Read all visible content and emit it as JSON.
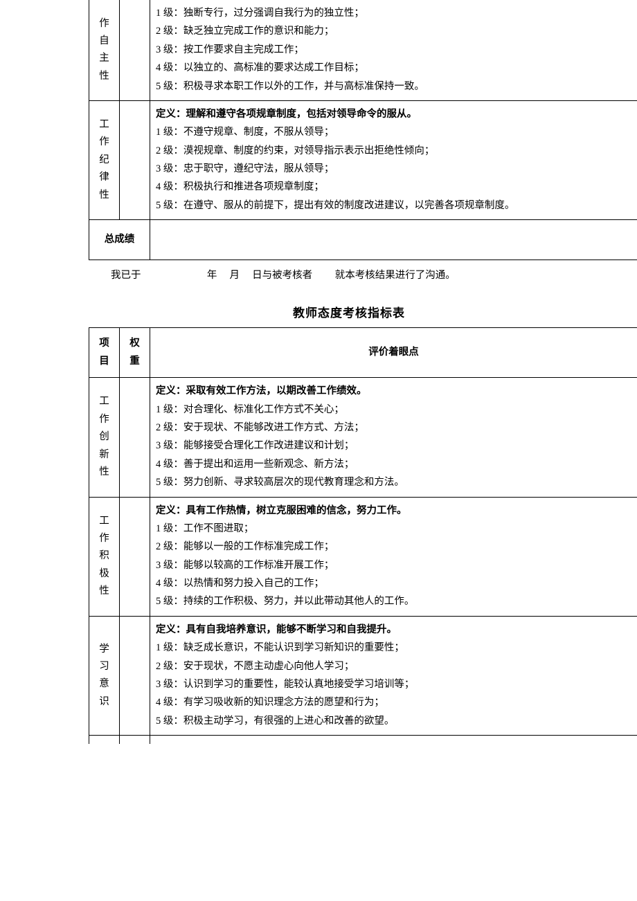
{
  "table1": {
    "rows": [
      {
        "item": [
          "作",
          "自",
          "主",
          "性"
        ],
        "weight": "",
        "content": {
          "definition": null,
          "levels": [
            {
              "n": "1",
              "t": "独断专行，过分强调自我行为的独立性；"
            },
            {
              "n": "2",
              "t": "缺乏独立完成工作的意识和能力；"
            },
            {
              "n": "3",
              "t": "按工作要求自主完成工作；"
            },
            {
              "n": "4",
              "t": "以独立的、高标准的要求达成工作目标；"
            },
            {
              "n": "5",
              "t": "积极寻求本职工作以外的工作，并与高标准保持一致。"
            }
          ]
        }
      },
      {
        "item": [
          "工",
          "作",
          "纪",
          "律",
          "性"
        ],
        "weight": "",
        "content": {
          "definition": "定义：理解和遵守各项规章制度，包括对领导命令的服从。",
          "levels": [
            {
              "n": "1",
              "t": "不遵守规章、制度，不服从领导；"
            },
            {
              "n": "2",
              "t": "漠视规章、制度的约束，对领导指示表示出拒绝性倾向；"
            },
            {
              "n": "3",
              "t": "忠于职守，遵纪守法，服从领导；"
            },
            {
              "n": "4",
              "t": "积极执行和推进各项规章制度；"
            },
            {
              "n": "5",
              "t": "在遵守、服从的前提下，提出有效的制度改进建议，以完善各项规章制度。"
            }
          ]
        }
      }
    ],
    "total_label": "总成绩",
    "total_value": ""
  },
  "footer": {
    "prefix": "我已于",
    "year_label": "年",
    "month_label": "月",
    "day_label": "日与被考核者",
    "suffix": "就本考核结果进行了沟通。"
  },
  "table2": {
    "title": "教师态度考核指标表",
    "headers": {
      "item": "项目",
      "weight": "权重",
      "content": "评价着眼点"
    },
    "rows": [
      {
        "item": [
          "工",
          "作",
          "创",
          "新",
          "性"
        ],
        "weight": "",
        "content": {
          "definition": "定义：采取有效工作方法，以期改善工作绩效。",
          "levels": [
            {
              "n": "1",
              "t": "对合理化、标准化工作方式不关心；"
            },
            {
              "n": "2",
              "t": "安于现状、不能够改进工作方式、方法；"
            },
            {
              "n": "3",
              "t": "能够接受合理化工作改进建议和计划；"
            },
            {
              "n": "4",
              "t": "善于提出和运用一些新观念、新方法；"
            },
            {
              "n": "5",
              "t": "努力创新、寻求较高层次的现代教育理念和方法。"
            }
          ]
        }
      },
      {
        "item": [
          "工",
          "作",
          "积",
          "极",
          "性"
        ],
        "weight": "",
        "content": {
          "definition": "定义：具有工作热情，树立克服困难的信念，努力工作。",
          "levels": [
            {
              "n": "1",
              "t": "工作不图进取；"
            },
            {
              "n": "2",
              "t": "能够以一般的工作标准完成工作；"
            },
            {
              "n": "3",
              "t": "能够以较高的工作标准开展工作；"
            },
            {
              "n": "4",
              "t": "以热情和努力投入自己的工作；"
            },
            {
              "n": "5",
              "t": "持续的工作积极、努力，并以此带动其他人的工作。"
            }
          ]
        }
      },
      {
        "item": [
          "学",
          "习",
          "意",
          "识"
        ],
        "weight": "",
        "content": {
          "definition": "定义：具有自我培养意识，能够不断学习和自我提升。",
          "levels": [
            {
              "n": "1",
              "t": "缺乏成长意识，不能认识到学习新知识的重要性；"
            },
            {
              "n": "2",
              "t": "安于现状，不愿主动虚心向他人学习；"
            },
            {
              "n": "3",
              "t": "认识到学习的重要性，能较认真地接受学习培训等；"
            },
            {
              "n": "4",
              "t": "有学习吸收新的知识理念方法的愿望和行为；"
            },
            {
              "n": "5",
              "t": "积极主动学习，有很强的上进心和改善的欲望。"
            }
          ]
        }
      }
    ]
  },
  "level_label": " 级："
}
